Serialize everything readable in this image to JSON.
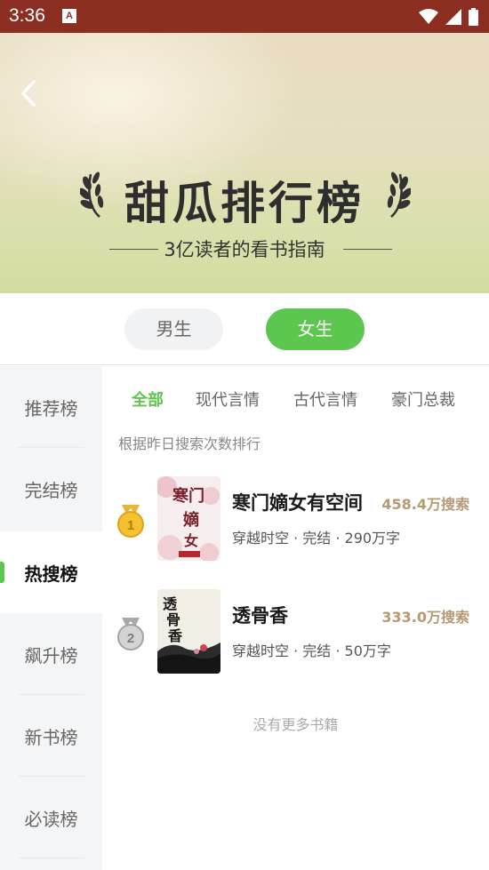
{
  "status_bar": {
    "time": "3:36",
    "notification_glyph": "A",
    "icons": [
      "wifi-icon",
      "signal-icon",
      "battery-icon"
    ]
  },
  "banner": {
    "title": "甜瓜排行榜",
    "subtitle": "3亿读者的看书指南"
  },
  "gender_tabs": [
    {
      "label": "男生",
      "selected": false
    },
    {
      "label": "女生",
      "selected": true
    }
  ],
  "sidebar": {
    "items": [
      {
        "label": "推荐榜",
        "active": false
      },
      {
        "label": "完结榜",
        "active": false
      },
      {
        "label": "热搜榜",
        "active": true
      },
      {
        "label": "飙升榜",
        "active": false
      },
      {
        "label": "新书榜",
        "active": false
      },
      {
        "label": "必读榜",
        "active": false
      }
    ]
  },
  "category_tabs": [
    {
      "label": "全部",
      "active": true
    },
    {
      "label": "现代言情",
      "active": false
    },
    {
      "label": "古代言情",
      "active": false
    },
    {
      "label": "豪门总裁",
      "active": false
    }
  ],
  "ranking_description": "根据昨日搜索次数排行",
  "books": [
    {
      "rank": "1",
      "medal": "gold",
      "title": "寒门嫡女有空间",
      "search_count": "458.4万搜索",
      "meta": "穿越时空 · 完结 · 290万字",
      "cover_text": "寒门嫡女",
      "cover_colors": {
        "bg": "#f6eeee",
        "accent": "#e7a9b6",
        "ink": "#7a1f2a"
      }
    },
    {
      "rank": "2",
      "medal": "silver",
      "title": "透骨香",
      "search_count": "333.0万搜索",
      "meta": "穿越时空 · 完结 · 50万字",
      "cover_text": "透骨香",
      "cover_colors": {
        "bg": "#f1eee6",
        "accent": "#2b2b2b",
        "ink": "#1a1a1a"
      }
    }
  ],
  "footer_text": "没有更多书籍",
  "colors": {
    "status_bar": "#8c2f22",
    "accent_green": "#5cc64e",
    "count_gold": "#b39a72"
  }
}
